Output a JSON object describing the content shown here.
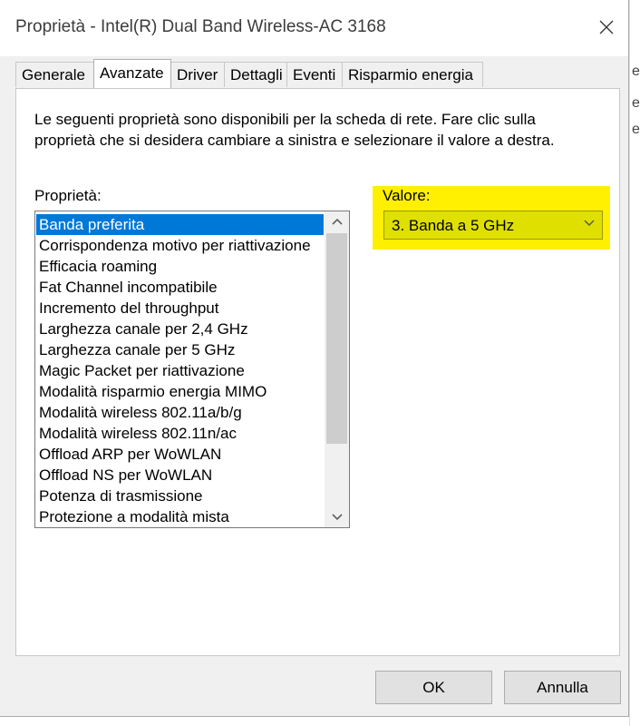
{
  "window": {
    "title": "Proprietà - Intel(R) Dual Band Wireless-AC 3168"
  },
  "tabs": [
    {
      "label": "Generale"
    },
    {
      "label": "Avanzate"
    },
    {
      "label": "Driver"
    },
    {
      "label": "Dettagli"
    },
    {
      "label": "Eventi"
    },
    {
      "label": "Risparmio energia"
    }
  ],
  "active_tab": "Avanzate",
  "description": "Le seguenti proprietà sono disponibili per la scheda di rete. Fare clic sulla proprietà che si desidera cambiare a sinistra e selezionare il valore a destra.",
  "properties": {
    "label": "Proprietà:",
    "selected": "Banda preferita",
    "items": [
      "Banda preferita",
      "Corrispondenza motivo per riattivazione",
      "Efficacia roaming",
      "Fat Channel incompatibile",
      "Incremento del throughput",
      "Larghezza canale per 2,4 GHz",
      "Larghezza canale per 5 GHz",
      "Magic Packet per riattivazione",
      "Modalità risparmio energia MIMO",
      "Modalità wireless 802.11a/b/g",
      "Modalità wireless 802.11n/ac",
      "Offload ARP per WoWLAN",
      "Offload NS per WoWLAN",
      "Potenza di trasmissione",
      "Protezione a modalità mista"
    ]
  },
  "value": {
    "label": "Valore:",
    "selected": "3. Banda a 5 GHz"
  },
  "buttons": {
    "ok": "OK",
    "cancel": "Annulla"
  },
  "colors": {
    "selection": "#0078d7",
    "highlight": "#ffef00"
  },
  "icons": {
    "close": "close-icon",
    "dropdown": "chevron-down-icon",
    "scroll_up": "chevron-up-icon",
    "scroll_down": "chevron-down-icon"
  }
}
